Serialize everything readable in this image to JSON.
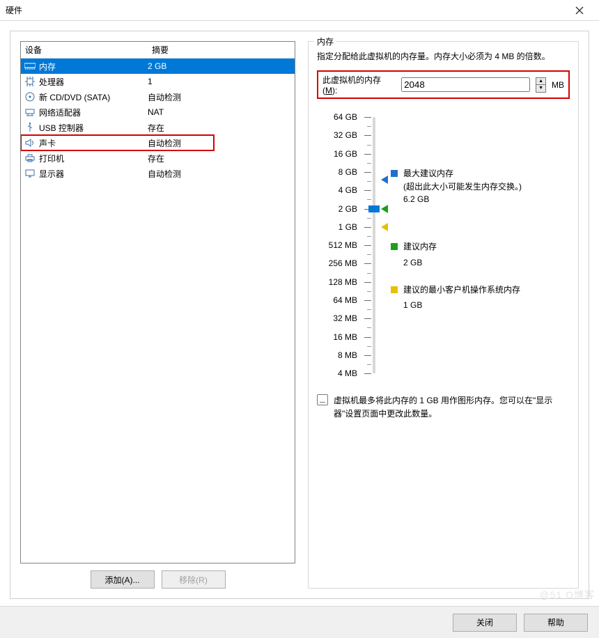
{
  "window": {
    "title": "硬件"
  },
  "device_table": {
    "headers": {
      "device": "设备",
      "summary": "摘要"
    },
    "rows": [
      {
        "icon": "memory-icon",
        "name": "内存",
        "summary": "2 GB",
        "selected": true
      },
      {
        "icon": "cpu-icon",
        "name": "处理器",
        "summary": "1"
      },
      {
        "icon": "disc-icon",
        "name": "新 CD/DVD (SATA)",
        "summary": "自动检测"
      },
      {
        "icon": "network-icon",
        "name": "网络适配器",
        "summary": "NAT"
      },
      {
        "icon": "usb-icon",
        "name": "USB 控制器",
        "summary": "存在"
      },
      {
        "icon": "sound-icon",
        "name": "声卡",
        "summary": "自动检测",
        "highlighted": true
      },
      {
        "icon": "printer-icon",
        "name": "打印机",
        "summary": "存在"
      },
      {
        "icon": "display-icon",
        "name": "显示器",
        "summary": "自动检测"
      }
    ]
  },
  "buttons": {
    "add": "添加(A)...",
    "remove": "移除(R)",
    "close": "关闭",
    "help": "帮助"
  },
  "memory": {
    "group_title": "内存",
    "desc": "指定分配给此虚拟机的内存量。内存大小必须为 4 MB 的倍数。",
    "input_label_prefix": "此虚拟机的内存(",
    "input_label_key": "M",
    "input_label_suffix": "):",
    "value": "2048",
    "unit": "MB",
    "ticks": [
      "64 GB",
      "32 GB",
      "16 GB",
      "8 GB",
      "4 GB",
      "2 GB",
      "1 GB",
      "512 MB",
      "256 MB",
      "128 MB",
      "64 MB",
      "32 MB",
      "16 MB",
      "8 MB",
      "4 MB"
    ],
    "slider_index": 5,
    "callouts": {
      "max": {
        "color": "#1f6fd0",
        "index": 3.4,
        "title": "最大建议内存",
        "detail": "(超出此大小可能发生内存交换。)",
        "value": "6.2 GB"
      },
      "rec": {
        "color": "#1aa01a",
        "index": 5,
        "title": "建议内存",
        "value": "2 GB"
      },
      "min": {
        "color": "#e7c100",
        "index": 6,
        "title": "建议的最小客户机操作系统内存",
        "value": "1 GB"
      }
    },
    "gfx_note": "虚拟机最多将此内存的 1 GB 用作图形内存。您可以在\"显示器\"设置页面中更改此数量。"
  },
  "watermark": "@51  O博客"
}
